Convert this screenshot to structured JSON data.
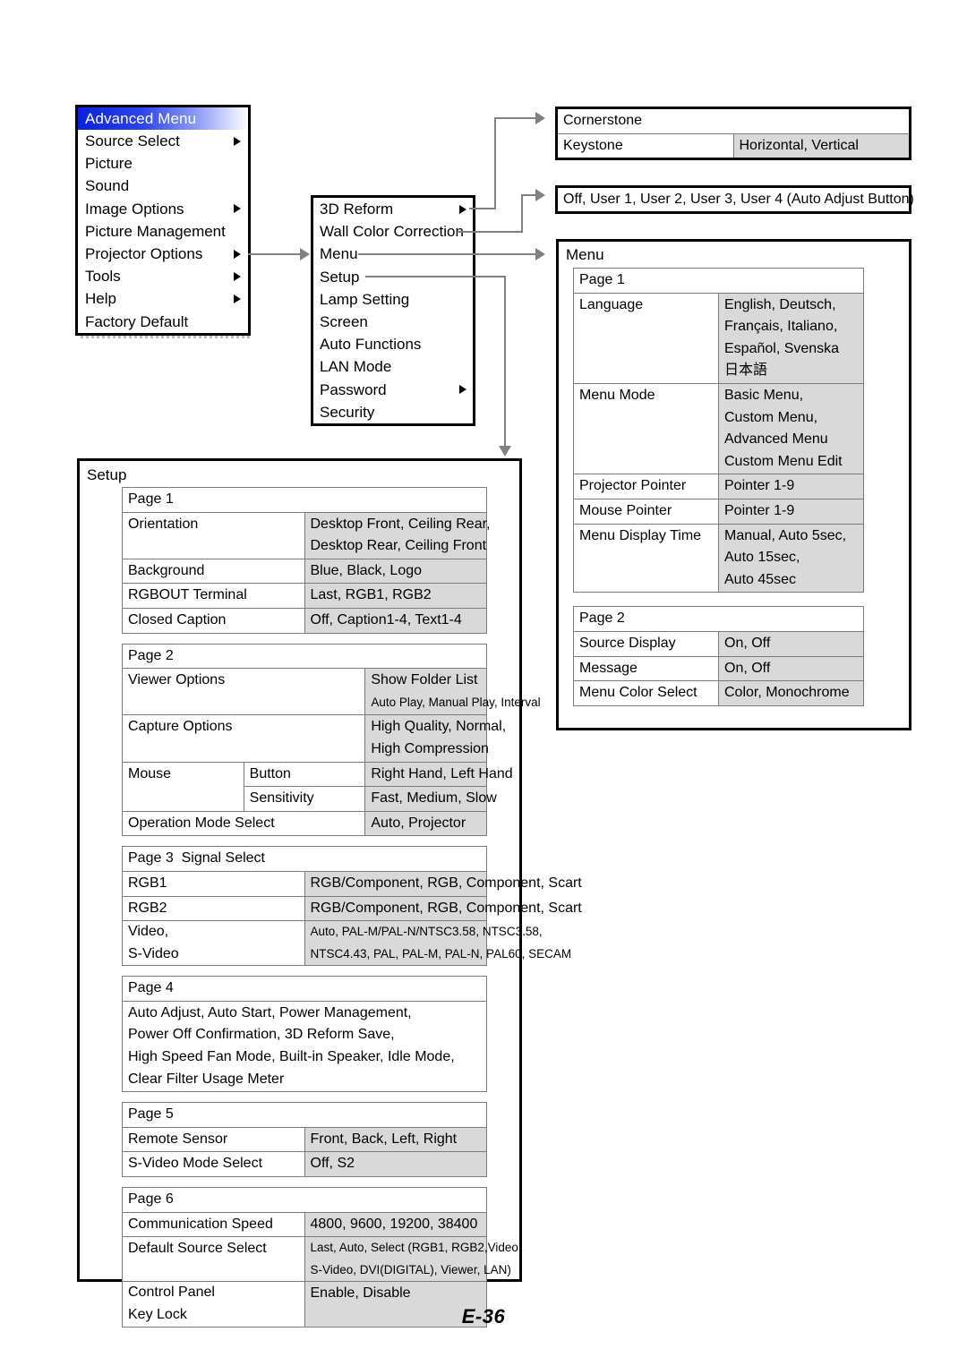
{
  "osd_menu": {
    "title": "Advanced Menu",
    "items": [
      {
        "label": "Source Select",
        "arrow": true
      },
      {
        "label": "Picture",
        "arrow": false
      },
      {
        "label": "Sound",
        "arrow": false
      },
      {
        "label": "Image Options",
        "arrow": true
      },
      {
        "label": "Picture Management",
        "arrow": false
      },
      {
        "label": "Projector Options",
        "arrow": true
      },
      {
        "label": "Tools",
        "arrow": true
      },
      {
        "label": "Help",
        "arrow": true
      },
      {
        "label": "Factory Default",
        "arrow": false
      }
    ]
  },
  "projector_options": {
    "items": [
      {
        "label": "3D Reform",
        "arrow": true
      },
      {
        "label": "Wall Color Correction",
        "arrow": false
      },
      {
        "label": "Menu",
        "arrow": false
      },
      {
        "label": "Setup",
        "arrow": false
      },
      {
        "label": "Lamp Setting",
        "arrow": false
      },
      {
        "label": "Screen",
        "arrow": false
      },
      {
        "label": "Auto Functions",
        "arrow": false
      },
      {
        "label": "LAN Mode",
        "arrow": false
      },
      {
        "label": "Password",
        "arrow": true
      },
      {
        "label": "Security",
        "arrow": false
      }
    ]
  },
  "reform_box": {
    "cornerstone": "Cornerstone",
    "keystone_label": "Keystone",
    "keystone_value": "Horizontal, Vertical"
  },
  "wall_color_box": {
    "value": "Off, User 1, User 2, User 3, User 4 (Auto  Adjust Button)"
  },
  "menu_box": {
    "title": "Menu",
    "page1": {
      "header": "Page 1",
      "rows": [
        {
          "label": "Language",
          "value": "English, Deutsch,\nFrançais, Italiano,\nEspañol, Svenska\n日本語"
        },
        {
          "label": "Menu Mode",
          "value": "Basic Menu,\nCustom Menu,\nAdvanced Menu\nCustom Menu Edit"
        },
        {
          "label": "Projector Pointer",
          "value": "Pointer 1-9"
        },
        {
          "label": "Mouse Pointer",
          "value": "Pointer 1-9"
        },
        {
          "label": "Menu Display Time",
          "value": "Manual, Auto 5sec,\nAuto 15sec,\nAuto 45sec"
        }
      ]
    },
    "page2": {
      "header": "Page 2",
      "rows": [
        {
          "label": "Source Display",
          "value": "On, Off"
        },
        {
          "label": "Message",
          "value": "On, Off"
        },
        {
          "label": "Menu Color Select",
          "value": "Color, Monochrome"
        }
      ]
    }
  },
  "setup_box": {
    "title": "Setup",
    "page1": {
      "header": "Page 1",
      "rows": [
        {
          "label": "Orientation",
          "value": "Desktop Front, Ceiling Rear,\nDesktop Rear, Ceiling Front"
        },
        {
          "label": "Background",
          "value": "Blue, Black, Logo"
        },
        {
          "label": "RGBOUT Terminal",
          "value": "Last, RGB1, RGB2"
        },
        {
          "label": "Closed Caption",
          "value": "Off, Caption1-4, Text1-4"
        }
      ]
    },
    "page2": {
      "header": "Page 2",
      "viewer_label": "Viewer Options",
      "viewer_value_1": "Show Folder List",
      "viewer_value_2": "Auto Play, Manual Play, Interval",
      "capture_label": "Capture Options",
      "capture_value": "High Quality, Normal,\nHigh Compression",
      "mouse_label": "Mouse",
      "mouse_button_label": "Button",
      "mouse_button_value": "Right Hand, Left Hand",
      "mouse_sens_label": "Sensitivity",
      "mouse_sens_value": "Fast, Medium, Slow",
      "opmode_label": "Operation Mode Select",
      "opmode_value": "Auto, Projector"
    },
    "page3": {
      "header": "Page 3",
      "header_sub": "Signal Select",
      "rows": [
        {
          "label": "RGB1",
          "value": "RGB/Component, RGB, Component, Scart"
        },
        {
          "label": "RGB2",
          "value": "RGB/Component, RGB, Component, Scart"
        }
      ],
      "video_label_1": "Video,",
      "video_label_2": "S-Video",
      "video_value_1": "Auto, PAL-M/PAL-N/NTSC3.58, NTSC3.58,",
      "video_value_2": "NTSC4.43, PAL, PAL-M, PAL-N, PAL60, SECAM"
    },
    "page4": {
      "header": "Page 4",
      "lines": [
        "Auto Adjust, Auto Start, Power Management,",
        "Power Off Confirmation, 3D Reform Save,",
        "High Speed Fan Mode, Built-in Speaker, Idle Mode,",
        "Clear Filter Usage Meter"
      ]
    },
    "page5": {
      "header": "Page 5",
      "rows": [
        {
          "label": "Remote Sensor",
          "value": "Front, Back, Left, Right"
        },
        {
          "label": "S-Video Mode Select",
          "value": "Off, S2"
        }
      ]
    },
    "page6": {
      "header": "Page 6",
      "comm_label": "Communication Speed",
      "comm_value": "4800, 9600, 19200, 38400",
      "dss_label": "Default Source Select",
      "dss_value_1": "Last, Auto, Select (RGB1, RGB2,Video,",
      "dss_value_2": "S-Video, DVI(DIGITAL), Viewer, LAN)",
      "cp_label_1": "Control Panel",
      "cp_label_2": "Key Lock",
      "cp_value": "Enable, Disable"
    }
  },
  "footer": {
    "page_number": "E-36"
  },
  "colors": {
    "accent": "#0a1fe0",
    "shade": "#d9d9d9",
    "connector": "#808080"
  }
}
